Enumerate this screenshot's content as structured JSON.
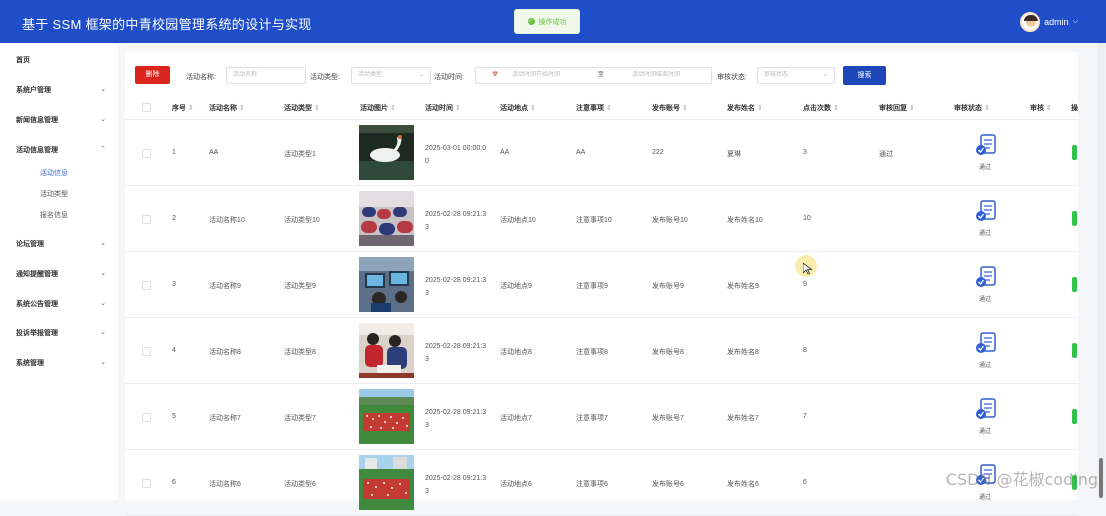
{
  "header": {
    "title": "基于 SSM 框架的中青校园管理系统的设计与实现",
    "toast": "操作成功",
    "user": "admin",
    "user_arrow": "⌵"
  },
  "sidebar": {
    "items": [
      {
        "label": "首页",
        "chevron": ""
      },
      {
        "label": "系统户管理",
        "chevron": "⌄"
      },
      {
        "label": "新闻信息管理",
        "chevron": "⌄"
      },
      {
        "label": "活动信息管理",
        "chevron": "⌃"
      },
      {
        "label": "论坛管理",
        "chevron": "⌄"
      },
      {
        "label": "通知提醒管理",
        "chevron": "⌄"
      },
      {
        "label": "系统公告管理",
        "chevron": "⌄"
      },
      {
        "label": "投诉举报管理",
        "chevron": "⌄"
      },
      {
        "label": "系统管理",
        "chevron": "⌄"
      }
    ],
    "sub_items": [
      {
        "label": "活动信息",
        "active": true
      },
      {
        "label": "活动类型",
        "active": false
      },
      {
        "label": "报名信息",
        "active": false
      }
    ]
  },
  "toolbar": {
    "delete_label": "删除",
    "name_label": "活动名称:",
    "name_placeholder": "活动名称",
    "type_label": "活动类型:",
    "type_placeholder": "活动类型",
    "time_label": "活动时间:",
    "start_placeholder": "活动时间开始时间",
    "range_sep": "至",
    "end_placeholder": "活动时间结束时间",
    "status_label": "审核状态:",
    "status_placeholder": "审核状态",
    "search_label": "搜索",
    "calendar_glyph": "📅",
    "select_arrow": "⌄"
  },
  "table": {
    "columns": [
      "序号",
      "活动名称",
      "活动类型",
      "活动图片",
      "活动时间",
      "活动地点",
      "注意事项",
      "发布账号",
      "发布姓名",
      "点击次数",
      "审核回复",
      "审核状态",
      "审核",
      "操作"
    ],
    "sort_glyph": "⇕",
    "rows": [
      {
        "no": "1",
        "name": "AA",
        "type": "活动类型1",
        "time": "2025-03-01 00:00:00",
        "place": "AA",
        "note": "AA",
        "account": "222",
        "publisher": "夏琳",
        "clicks": "3",
        "reply": "通过",
        "audit": "通过",
        "photo": "swan"
      },
      {
        "no": "2",
        "name": "活动名称10",
        "type": "活动类型10",
        "time": "2025-02-28 09:21:33",
        "place": "活动地点10",
        "note": "注意事项10",
        "account": "发布账号10",
        "publisher": "发布姓名10",
        "clicks": "10",
        "reply": "",
        "audit": "通过",
        "photo": "classroom"
      },
      {
        "no": "3",
        "name": "活动名称9",
        "type": "活动类型9",
        "time": "2025-02-28 09:21:33",
        "place": "活动地点9",
        "note": "注意事项9",
        "account": "发布账号9",
        "publisher": "发布姓名9",
        "clicks": "9",
        "reply": "",
        "audit": "通过",
        "photo": "computer"
      },
      {
        "no": "4",
        "name": "活动名称8",
        "type": "活动类型8",
        "time": "2025-02-28 09:21:33",
        "place": "活动地点8",
        "note": "注意事项8",
        "account": "发布账号8",
        "publisher": "发布姓名8",
        "clicks": "8",
        "reply": "",
        "audit": "通过",
        "photo": "students"
      },
      {
        "no": "5",
        "name": "活动名称7",
        "type": "活动类型7",
        "time": "2025-02-28 09:21:33",
        "place": "活动地点7",
        "note": "注意事项7",
        "account": "发布账号7",
        "publisher": "发布姓名7",
        "clicks": "7",
        "reply": "",
        "audit": "通过",
        "photo": "field"
      },
      {
        "no": "6",
        "name": "活动名称6",
        "type": "活动类型6",
        "time": "2025-02-28 09:21:33",
        "place": "活动地点6",
        "note": "注意事项6",
        "account": "发布账号6",
        "publisher": "发布姓名6",
        "clicks": "6",
        "reply": "",
        "audit": "通过",
        "photo": "field2"
      }
    ]
  },
  "watermark": "CSDN @花椒coding",
  "colors": {
    "header": "#1f4ec8",
    "delete": "#d9251c",
    "search": "#1d46b8",
    "active": "#3b6fd8",
    "toggle": "#33c24a"
  }
}
